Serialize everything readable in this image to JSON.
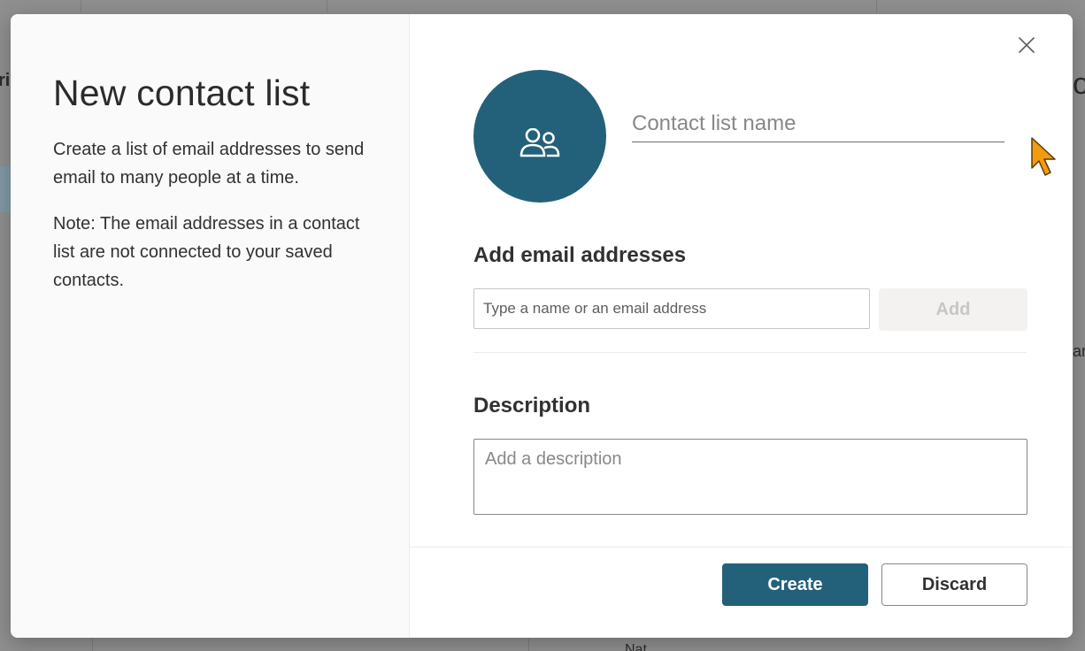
{
  "background": {
    "fragment_left": "ri",
    "fragment_right_top": "o",
    "fragment_right_mid": "ar",
    "fragment_bottom": "Nat"
  },
  "dialog": {
    "title": "New contact list",
    "intro": "Create a list of email addresses to send email to many people at a time.",
    "note": "Note: The email addresses in a contact list are not connected to your saved contacts.",
    "close_icon": "close-icon",
    "avatar_icon": "people-icon",
    "name_placeholder": "Contact list name",
    "add_section_label": "Add email addresses",
    "email_placeholder": "Type a name or an email address",
    "add_button": "Add",
    "description_label": "Description",
    "description_placeholder": "Add a description",
    "create_button": "Create",
    "discard_button": "Discard"
  },
  "colors": {
    "accent": "#23617a",
    "overlay": "#8f8f8f",
    "left_pane": "#fafafa",
    "disabled_button": "#f3f2f1"
  }
}
